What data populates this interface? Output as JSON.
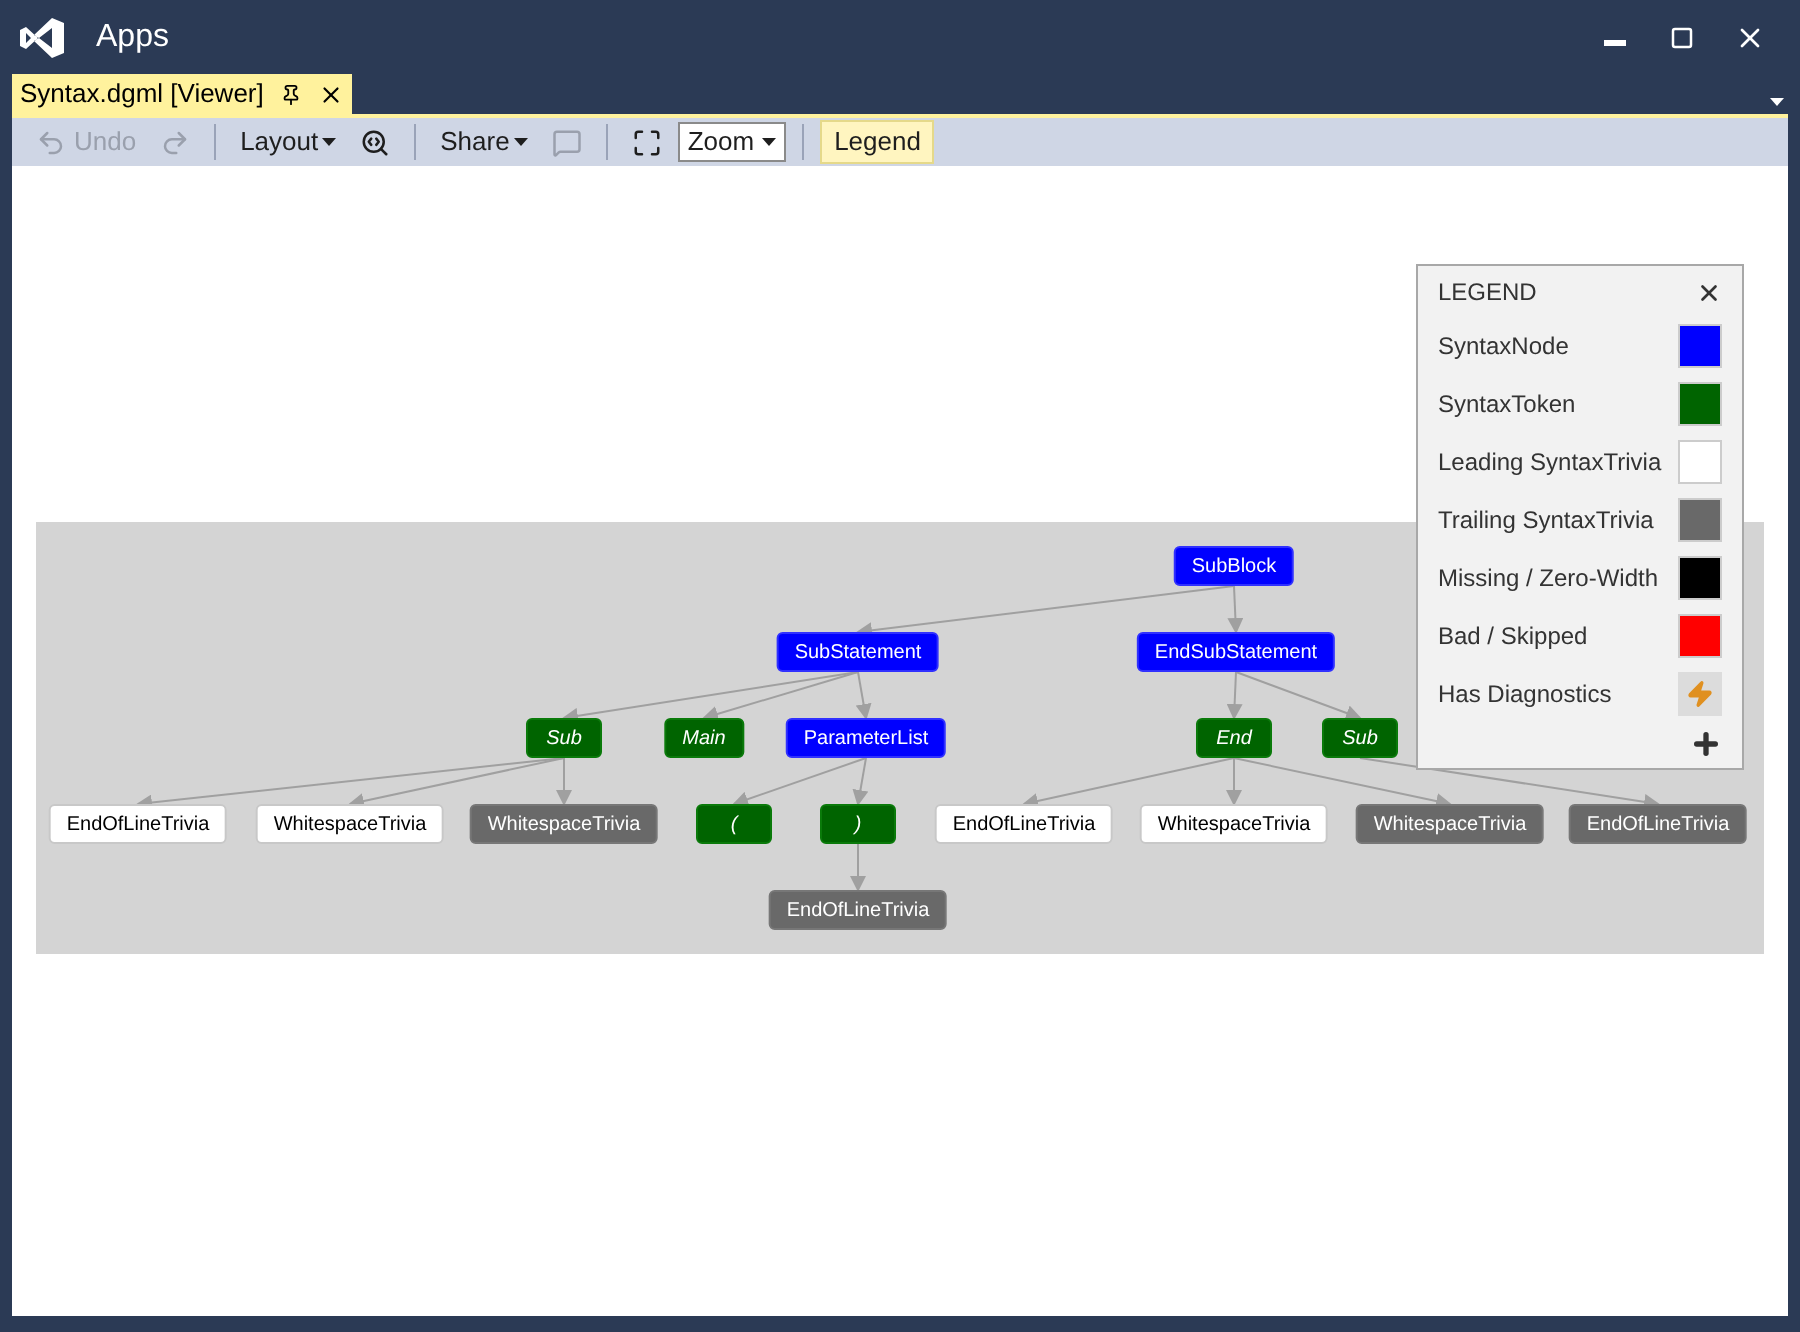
{
  "window": {
    "title": "Apps"
  },
  "document_tab": {
    "label": "Syntax.dgml [Viewer]",
    "selected": true
  },
  "toolbar": [
    {
      "kind": "undo",
      "label": "Undo",
      "disabled": true
    },
    {
      "kind": "redo",
      "disabled": true
    },
    {
      "kind": "separator"
    },
    {
      "kind": "menu",
      "label": "Layout",
      "disabled": false
    },
    {
      "kind": "find",
      "disabled": false
    },
    {
      "kind": "separator"
    },
    {
      "kind": "menu",
      "label": "Share",
      "disabled": false
    },
    {
      "kind": "comment",
      "disabled": true
    },
    {
      "kind": "separator"
    },
    {
      "kind": "fit",
      "disabled": false
    },
    {
      "kind": "select",
      "value": "Zoom"
    },
    {
      "kind": "separator"
    },
    {
      "kind": "toggle",
      "label": "Legend",
      "selected": true
    }
  ],
  "graph": {
    "root": {
      "label": "SubBlock",
      "kind": "node",
      "children": [
        {
          "label": "SubStatement",
          "kind": "node",
          "children": [
            {
              "label": "Sub",
              "kind": "token",
              "children": [
                {
                  "label": "EndOfLineTrivia",
                  "kind": "leading"
                },
                {
                  "label": "WhitespaceTrivia",
                  "kind": "leading"
                },
                {
                  "label": "WhitespaceTrivia",
                  "kind": "trailing"
                }
              ]
            },
            {
              "label": "Main",
              "kind": "token"
            },
            {
              "label": "ParameterList",
              "kind": "node",
              "children": [
                {
                  "label": "(",
                  "kind": "token"
                },
                {
                  "label": ")",
                  "kind": "token",
                  "children": [
                    {
                      "label": "EndOfLineTrivia",
                      "kind": "trailing"
                    }
                  ]
                }
              ]
            }
          ]
        },
        {
          "label": "EndSubStatement",
          "kind": "node",
          "children": [
            {
              "label": "End",
              "kind": "token",
              "children": [
                {
                  "label": "EndOfLineTrivia",
                  "kind": "leading"
                },
                {
                  "label": "WhitespaceTrivia",
                  "kind": "leading"
                },
                {
                  "label": "WhitespaceTrivia",
                  "kind": "trailing"
                }
              ]
            },
            {
              "label": "Sub",
              "kind": "token",
              "children": [
                {
                  "label": "EndOfLineTrivia",
                  "kind": "trailing"
                }
              ]
            }
          ]
        }
      ]
    }
  },
  "legend": {
    "title": "LEGEND",
    "items": [
      {
        "label": "SyntaxNode",
        "kind": "swatch",
        "color": "#0000ff"
      },
      {
        "label": "SyntaxToken",
        "kind": "swatch",
        "color": "#006400"
      },
      {
        "label": "Leading SyntaxTrivia",
        "kind": "swatch",
        "color": "#ffffff"
      },
      {
        "label": "Trailing SyntaxTrivia",
        "kind": "swatch",
        "color": "#696969"
      },
      {
        "label": "Missing / Zero-Width",
        "kind": "swatch",
        "color": "#000000"
      },
      {
        "label": "Bad / Skipped",
        "kind": "swatch",
        "color": "#ff0000"
      },
      {
        "label": "Has Diagnostics",
        "kind": "icon"
      }
    ]
  }
}
